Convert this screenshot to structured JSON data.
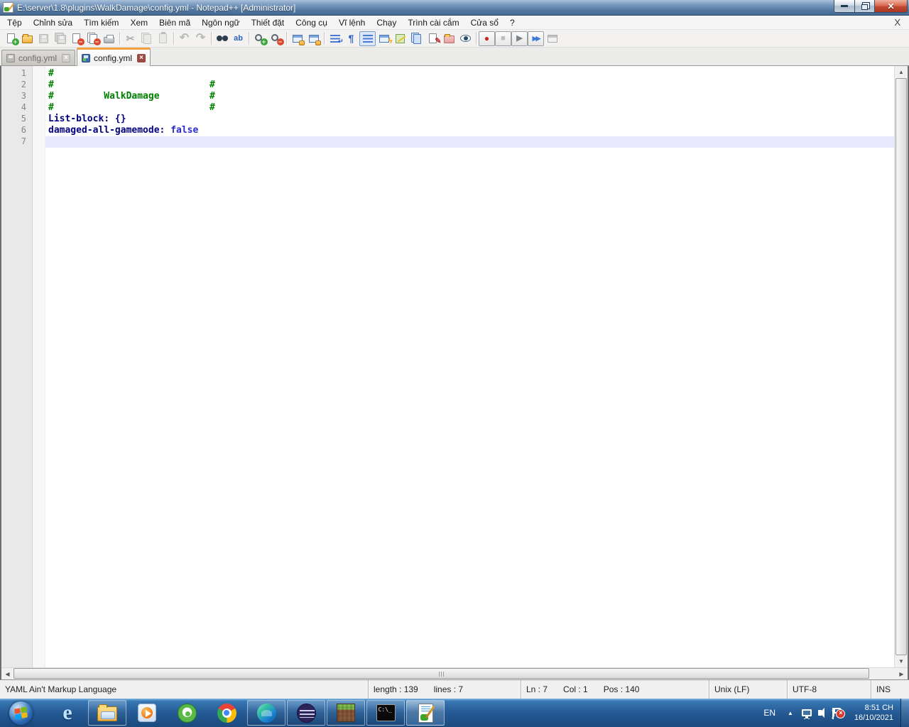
{
  "window": {
    "title": "E:\\server\\1.8\\plugins\\WalkDamage\\config.yml - Notepad++ [Administrator]"
  },
  "menu_bar": {
    "items": [
      {
        "label": "Tệp",
        "slug": "tep"
      },
      {
        "label": "Chỉnh sửa",
        "slug": "chinh-sua"
      },
      {
        "label": "Tìm kiếm",
        "slug": "tim-kiem"
      },
      {
        "label": "Xem",
        "slug": "xem"
      },
      {
        "label": "Biên mã",
        "slug": "bien-ma"
      },
      {
        "label": "Ngôn ngữ",
        "slug": "ngon-ngu"
      },
      {
        "label": "Thiết đặt",
        "slug": "thiet-dat"
      },
      {
        "label": "Công cụ",
        "slug": "cong-cu"
      },
      {
        "label": "Vĩ lệnh",
        "slug": "vi-lenh"
      },
      {
        "label": "Chạy",
        "slug": "chay"
      },
      {
        "label": "Trình cài cắm",
        "slug": "trinh-cai-cam"
      },
      {
        "label": "Cửa sổ",
        "slug": "cua-so"
      },
      {
        "label": "?",
        "slug": "help"
      }
    ],
    "close_document_label": "X"
  },
  "toolbar": {
    "groups": [
      [
        {
          "name": "new-file",
          "kind": "page",
          "o": {
            "badge": "+",
            "bcolor": "#3aa73a"
          }
        },
        {
          "name": "open-file",
          "kind": "folder",
          "o": {}
        },
        {
          "name": "save",
          "kind": "disk",
          "disabled": true,
          "o": {}
        },
        {
          "name": "save-all",
          "kind": "disk",
          "disabled": true,
          "o": {
            "double": true
          }
        },
        {
          "name": "close",
          "kind": "page",
          "o": {
            "badge": "−",
            "bcolor": "#d84a30"
          }
        },
        {
          "name": "close-all",
          "kind": "page",
          "o": {
            "double": true,
            "badge": "−",
            "bcolor": "#d84a30"
          }
        },
        {
          "name": "print",
          "kind": "printer",
          "o": {}
        }
      ],
      [
        {
          "name": "cut",
          "kind": "glyph",
          "disabled": true,
          "o": {
            "glyph": "✂",
            "gcolor": "#6d757d",
            "gsize": "14px"
          }
        },
        {
          "name": "copy",
          "kind": "page",
          "disabled": true,
          "o": {
            "double": true,
            "fill": "#dfe2e5",
            "border": "#9aa0a6"
          }
        },
        {
          "name": "paste",
          "kind": "page",
          "disabled": true,
          "o": {
            "clip": true,
            "fill": "#dfe2e5",
            "border": "#9aa0a6"
          }
        }
      ],
      [
        {
          "name": "undo",
          "kind": "glyph",
          "disabled": true,
          "o": {
            "glyph": "↶",
            "gcolor": "#878c91",
            "gsize": "16px"
          }
        },
        {
          "name": "redo",
          "kind": "glyph",
          "disabled": true,
          "o": {
            "glyph": "↷",
            "gcolor": "#878c91",
            "gsize": "16px"
          }
        }
      ],
      [
        {
          "name": "find",
          "kind": "binoc",
          "o": {}
        },
        {
          "name": "replace",
          "kind": "glyph",
          "o": {
            "glyph": "ab",
            "gcolor": "#2563c0",
            "gsize": "11px"
          }
        }
      ],
      [
        {
          "name": "zoom-in",
          "kind": "mag",
          "o": {
            "badge": "+",
            "bcolor": "#3aa73a"
          }
        },
        {
          "name": "zoom-out",
          "kind": "mag",
          "o": {
            "badge": "−",
            "bcolor": "#d84a30"
          }
        }
      ],
      [
        {
          "name": "sync-vertical-scrolling",
          "kind": "win",
          "o": {
            "lock": true
          }
        },
        {
          "name": "sync-horizontal-scrolling",
          "kind": "win",
          "o": {
            "lock": true
          }
        }
      ],
      [
        {
          "name": "word-wrap",
          "kind": "stripes",
          "o": {
            "glyph": "↵",
            "gcolor": "#2a5fd0",
            "gsize": "9px"
          }
        },
        {
          "name": "show-all-characters",
          "kind": "glyph",
          "o": {
            "glyph": "¶",
            "gcolor": "#2a5fd0",
            "gsize": "14px"
          }
        },
        {
          "name": "show-indent-guide",
          "kind": "stripes",
          "pressed": true,
          "o": {}
        },
        {
          "name": "function-list",
          "kind": "win",
          "o": {
            "glyph": "ϟ",
            "gcolor": "#f0a000",
            "gsize": "11px"
          }
        },
        {
          "name": "document-map",
          "kind": "map",
          "o": {}
        },
        {
          "name": "document-list",
          "kind": "page",
          "o": {
            "double": true,
            "fill": "#cfe0f8",
            "border": "#4a77b8"
          }
        },
        {
          "name": "edit-marker",
          "kind": "page",
          "o": {
            "glyph": "✎",
            "gcolor": "#c03030",
            "gsize": "11px"
          }
        },
        {
          "name": "folder-as-workspace",
          "kind": "folder",
          "o": {
            "fill": "linear-gradient(#f5c8c8,#e8a0a0)",
            "border": "#b87070"
          }
        },
        {
          "name": "monitoring",
          "kind": "eye",
          "o": {}
        }
      ],
      [
        {
          "name": "macro-record",
          "kind": "glyph",
          "framed": true,
          "o": {
            "glyph": "●",
            "gcolor": "#cc2222",
            "gsize": "12px"
          }
        },
        {
          "name": "macro-stop",
          "kind": "glyph",
          "framed": true,
          "disabled": true,
          "o": {
            "glyph": "■",
            "gcolor": "#8d9399",
            "gsize": "11px"
          }
        },
        {
          "name": "macro-play",
          "kind": "glyph",
          "framed": true,
          "o": {
            "glyph": "▶",
            "gcolor": "#7a8288",
            "gsize": "11px"
          }
        },
        {
          "name": "macro-run-multiple",
          "kind": "glyph",
          "framed": true,
          "o": {
            "glyph": "▶▶",
            "gcolor": "#3a7ad8",
            "gsize": "9px",
            "ls": "-2px"
          }
        },
        {
          "name": "macro-save",
          "kind": "win",
          "disabled": true,
          "o": {}
        }
      ]
    ]
  },
  "tab_bar": {
    "tabs": [
      {
        "label": "config.yml",
        "state": "inactive"
      },
      {
        "label": "config.yml",
        "state": "active"
      }
    ]
  },
  "editor": {
    "token_colors": {
      "comment": "#008000",
      "key": "#000080",
      "literal": "#2b2bd5",
      "plain": "#000000"
    },
    "current_line": 7,
    "lines": [
      {
        "n": 1,
        "tokens": [
          [
            "comment",
            "#"
          ]
        ]
      },
      {
        "n": 2,
        "tokens": [
          [
            "comment",
            "#                            #"
          ]
        ]
      },
      {
        "n": 3,
        "tokens": [
          [
            "comment",
            "#         WalkDamage         #"
          ]
        ]
      },
      {
        "n": 4,
        "tokens": [
          [
            "comment",
            "#                            #"
          ]
        ]
      },
      {
        "n": 5,
        "tokens": [
          [
            "key",
            "List-block:"
          ],
          [
            "plain",
            " "
          ],
          [
            "key",
            "{}"
          ]
        ]
      },
      {
        "n": 6,
        "tokens": [
          [
            "key",
            "damaged-all-gamemode:"
          ],
          [
            "plain",
            " "
          ],
          [
            "literal",
            "false"
          ]
        ]
      },
      {
        "n": 7,
        "tokens": []
      }
    ]
  },
  "status_bar": {
    "doc_type": "YAML Ain't Markup Language",
    "length_label": "length : 139",
    "lines_label": "lines : 7",
    "ln": "Ln : 7",
    "col": "Col : 1",
    "pos": "Pos : 140",
    "eol": "Unix (LF)",
    "encoding": "UTF-8",
    "typing_mode": "INS"
  },
  "taskbar": {
    "apps": [
      {
        "slug": "start",
        "running": false,
        "active": false
      },
      {
        "slug": "internet-explorer",
        "running": false,
        "active": false,
        "glyph": "e"
      },
      {
        "slug": "windows-explorer",
        "running": true,
        "active": false
      },
      {
        "slug": "windows-media-player",
        "running": false,
        "active": false
      },
      {
        "slug": "coc-coc",
        "running": false,
        "active": false
      },
      {
        "slug": "chrome",
        "running": false,
        "active": false
      },
      {
        "slug": "edge",
        "running": true,
        "active": false
      },
      {
        "slug": "eclipse",
        "running": true,
        "active": false
      },
      {
        "slug": "minecraft",
        "running": true,
        "active": false
      },
      {
        "slug": "command-prompt",
        "running": true,
        "active": false,
        "text": "C:\\_"
      },
      {
        "slug": "notepad-plus-plus",
        "running": true,
        "active": true
      }
    ],
    "tray": {
      "language": "EN",
      "hidden_icons_glyph": "▲",
      "clock_time": "8:51 CH",
      "clock_date": "16/10/2021"
    }
  }
}
